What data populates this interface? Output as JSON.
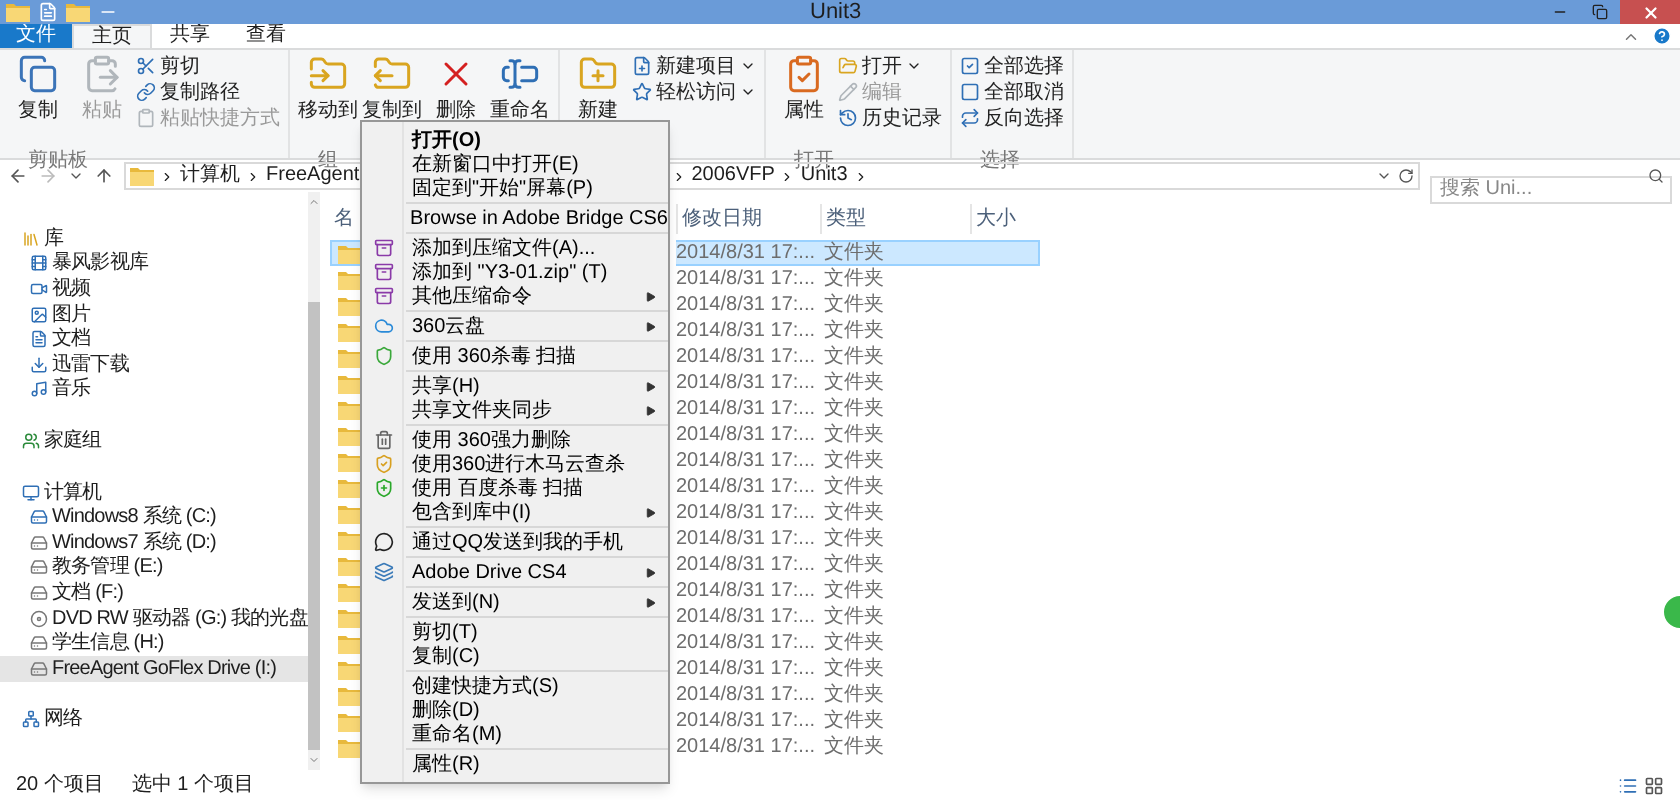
{
  "title_bar": {
    "title": "Unit3"
  },
  "ribbon_tabs": [
    {
      "label": "文件",
      "kind": "backstage",
      "selected": false
    },
    {
      "label": "主页",
      "kind": "tab",
      "selected": true
    },
    {
      "label": "共享",
      "kind": "tab",
      "selected": false
    },
    {
      "label": "查看",
      "kind": "tab",
      "selected": false
    }
  ],
  "ribbon_groups": [
    {
      "label": "剪贴板",
      "large": [
        {
          "label": "复制",
          "disabled": false
        },
        {
          "label": "粘贴",
          "disabled": true
        }
      ],
      "small": [
        {
          "label": "剪切",
          "disabled": false,
          "dropdown": false
        },
        {
          "label": "复制路径",
          "disabled": false,
          "dropdown": false
        },
        {
          "label": "粘贴快捷方式",
          "disabled": true,
          "dropdown": false
        }
      ]
    },
    {
      "label": "组",
      "large": [
        {
          "label": "移动到",
          "disabled": false
        },
        {
          "label": "复制到",
          "disabled": false
        },
        {
          "label": "删除",
          "disabled": false
        },
        {
          "label": "重命名",
          "disabled": false
        }
      ]
    },
    {
      "large": [
        {
          "label": "新建",
          "disabled": false
        }
      ],
      "small": [
        {
          "label": "新建项目",
          "disabled": false,
          "dropdown": true
        },
        {
          "label": "轻松访问",
          "disabled": false,
          "dropdown": true
        }
      ]
    },
    {
      "label": "打开",
      "large": [
        {
          "label": "属性",
          "disabled": false
        }
      ],
      "small": [
        {
          "label": "打开",
          "disabled": false,
          "dropdown": true
        },
        {
          "label": "编辑",
          "disabled": true,
          "dropdown": false
        },
        {
          "label": "历史记录",
          "disabled": false,
          "dropdown": false
        }
      ]
    },
    {
      "label": "选择",
      "small": [
        {
          "label": "全部选择",
          "disabled": false,
          "dropdown": false
        },
        {
          "label": "全部取消",
          "disabled": false,
          "dropdown": false
        },
        {
          "label": "反向选择",
          "disabled": false,
          "dropdown": false
        }
      ]
    }
  ],
  "address": {
    "path_left": [
      "计算机",
      "FreeAgent"
    ],
    "path_right": [
      "2006VFP",
      "Unit3"
    ]
  },
  "search": {
    "placeholder": "搜索 Uni..."
  },
  "navigation": [
    {
      "label": "库",
      "selected": false,
      "children": [
        {
          "label": "暴风影视库",
          "selected": false
        },
        {
          "label": "视频",
          "selected": false
        },
        {
          "label": "图片",
          "selected": false
        },
        {
          "label": "文档",
          "selected": false
        },
        {
          "label": "迅雷下载",
          "selected": false
        },
        {
          "label": "音乐",
          "selected": false
        }
      ]
    },
    {
      "label": "家庭组",
      "selected": false
    },
    {
      "label": "计算机",
      "selected": false,
      "children": [
        {
          "label": "Windows8 系统 (C:)",
          "selected": false
        },
        {
          "label": "Windows7 系统 (D:)",
          "selected": false
        },
        {
          "label": "教务管理 (E:)",
          "selected": false
        },
        {
          "label": "文档 (F:)",
          "selected": false
        },
        {
          "label": "DVD RW 驱动器 (G:) 我的光盘",
          "selected": false
        },
        {
          "label": "学生信息 (H:)",
          "selected": false
        },
        {
          "label": "FreeAgent GoFlex Drive (I:)",
          "selected": true
        }
      ]
    },
    {
      "label": "网络",
      "selected": false
    }
  ],
  "file_list": {
    "columns": [
      "名",
      "修改日期",
      "类型",
      "大小"
    ],
    "rows": [
      {
        "date": "2014/8/31 17:...",
        "type": "文件夹",
        "selected": true
      },
      {
        "date": "2014/8/31 17:...",
        "type": "文件夹",
        "selected": false
      },
      {
        "date": "2014/8/31 17:...",
        "type": "文件夹",
        "selected": false
      },
      {
        "date": "2014/8/31 17:...",
        "type": "文件夹",
        "selected": false
      },
      {
        "date": "2014/8/31 17:...",
        "type": "文件夹",
        "selected": false
      },
      {
        "date": "2014/8/31 17:...",
        "type": "文件夹",
        "selected": false
      },
      {
        "date": "2014/8/31 17:...",
        "type": "文件夹",
        "selected": false
      },
      {
        "date": "2014/8/31 17:...",
        "type": "文件夹",
        "selected": false
      },
      {
        "date": "2014/8/31 17:...",
        "type": "文件夹",
        "selected": false
      },
      {
        "date": "2014/8/31 17:...",
        "type": "文件夹",
        "selected": false
      },
      {
        "date": "2014/8/31 17:...",
        "type": "文件夹",
        "selected": false
      },
      {
        "date": "2014/8/31 17:...",
        "type": "文件夹",
        "selected": false
      },
      {
        "date": "2014/8/31 17:...",
        "type": "文件夹",
        "selected": false
      },
      {
        "date": "2014/8/31 17:...",
        "type": "文件夹",
        "selected": false
      },
      {
        "date": "2014/8/31 17:...",
        "type": "文件夹",
        "selected": false
      },
      {
        "date": "2014/8/31 17:...",
        "type": "文件夹",
        "selected": false
      },
      {
        "date": "2014/8/31 17:...",
        "type": "文件夹",
        "selected": false
      },
      {
        "date": "2014/8/31 17:...",
        "type": "文件夹",
        "selected": false
      },
      {
        "date": "2014/8/31 17:...",
        "type": "文件夹",
        "selected": false
      },
      {
        "date": "2014/8/31 17:...",
        "type": "文件夹",
        "selected": false
      }
    ]
  },
  "context_menu": {
    "items": [
      {
        "kind": "item",
        "label": "打开(O)",
        "default": true,
        "submenu": false
      },
      {
        "kind": "item",
        "label": "在新窗口中打开(E)",
        "default": false,
        "submenu": false
      },
      {
        "kind": "item",
        "label": "固定到\"开始\"屏幕(P)",
        "default": false,
        "submenu": false
      },
      {
        "kind": "separator"
      },
      {
        "kind": "item",
        "label": "Browse in Adobe Bridge CS6",
        "default": false,
        "submenu": false
      },
      {
        "kind": "separator"
      },
      {
        "kind": "item",
        "label": "添加到压缩文件(A)...",
        "default": false,
        "submenu": false
      },
      {
        "kind": "item",
        "label": "添加到 \"Y3-01.zip\" (T)",
        "default": false,
        "submenu": false
      },
      {
        "kind": "item",
        "label": "其他压缩命令",
        "default": false,
        "submenu": true
      },
      {
        "kind": "separator"
      },
      {
        "kind": "item",
        "label": "360云盘",
        "default": false,
        "submenu": true
      },
      {
        "kind": "separator"
      },
      {
        "kind": "item",
        "label": "使用 360杀毒 扫描",
        "default": false,
        "submenu": false
      },
      {
        "kind": "separator"
      },
      {
        "kind": "item",
        "label": "共享(H)",
        "default": false,
        "submenu": true
      },
      {
        "kind": "item",
        "label": "共享文件夹同步",
        "default": false,
        "submenu": true
      },
      {
        "kind": "separator"
      },
      {
        "kind": "item",
        "label": "使用 360强力删除",
        "default": false,
        "submenu": false
      },
      {
        "kind": "item",
        "label": "使用360进行木马云查杀",
        "default": false,
        "submenu": false
      },
      {
        "kind": "item",
        "label": "使用 百度杀毒 扫描",
        "default": false,
        "submenu": false
      },
      {
        "kind": "item",
        "label": "包含到库中(I)",
        "default": false,
        "submenu": true
      },
      {
        "kind": "separator"
      },
      {
        "kind": "item",
        "label": "通过QQ发送到我的手机",
        "default": false,
        "submenu": false
      },
      {
        "kind": "separator"
      },
      {
        "kind": "item",
        "label": "Adobe Drive CS4",
        "default": false,
        "submenu": true
      },
      {
        "kind": "separator"
      },
      {
        "kind": "item",
        "label": "发送到(N)",
        "default": false,
        "submenu": true
      },
      {
        "kind": "separator"
      },
      {
        "kind": "item",
        "label": "剪切(T)",
        "default": false,
        "submenu": false
      },
      {
        "kind": "item",
        "label": "复制(C)",
        "default": false,
        "submenu": false
      },
      {
        "kind": "separator"
      },
      {
        "kind": "item",
        "label": "创建快捷方式(S)",
        "default": false,
        "submenu": false
      },
      {
        "kind": "item",
        "label": "删除(D)",
        "default": false,
        "submenu": false
      },
      {
        "kind": "item",
        "label": "重命名(M)",
        "default": false,
        "submenu": false
      },
      {
        "kind": "separator"
      },
      {
        "kind": "item",
        "label": "属性(R)",
        "default": false,
        "submenu": false
      }
    ]
  },
  "status_bar": {
    "count": "20 个项目",
    "selection": "选中 1 个项目"
  }
}
